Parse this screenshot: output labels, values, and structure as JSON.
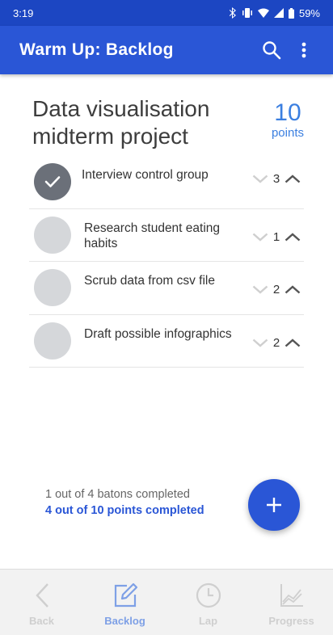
{
  "status_bar": {
    "time": "3:19",
    "battery": "59%"
  },
  "app_bar": {
    "title": "Warm Up: Backlog"
  },
  "project": {
    "title": "Data visualisation midterm project",
    "points": "10",
    "points_label": "points"
  },
  "tasks": [
    {
      "label": "Interview control group",
      "points": "3",
      "completed": true
    },
    {
      "label": "Research student eating habits",
      "points": "1",
      "completed": false
    },
    {
      "label": "Scrub data from csv file",
      "points": "2",
      "completed": false
    },
    {
      "label": "Draft possible infographics",
      "points": "2",
      "completed": false
    }
  ],
  "summary": {
    "batons": "1 out of 4 batons completed",
    "points": "4 out of 10 points completed"
  },
  "nav": {
    "back": "Back",
    "backlog": "Backlog",
    "lap": "Lap",
    "progress": "Progress"
  },
  "colors": {
    "primary": "#2a56d6",
    "status_bar": "#1c46c2",
    "accent": "#3b7fe0"
  }
}
